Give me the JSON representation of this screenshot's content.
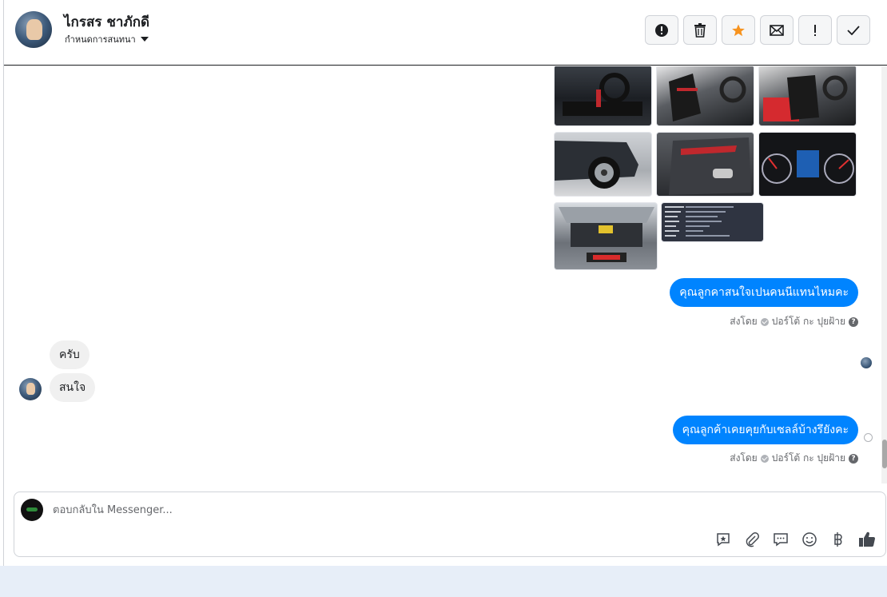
{
  "header": {
    "contact_name": "ไกรสร ชาภักดี",
    "assign_label": "กำหนดการสนทนา",
    "actions": [
      {
        "name": "mark-spam-button",
        "icon": "alert-circle-icon"
      },
      {
        "name": "delete-button",
        "icon": "trash-icon"
      },
      {
        "name": "star-button",
        "icon": "star-icon"
      },
      {
        "name": "mark-unread-button",
        "icon": "envelope-icon"
      },
      {
        "name": "follow-up-button",
        "icon": "exclamation-icon"
      },
      {
        "name": "mark-done-button",
        "icon": "check-icon"
      }
    ]
  },
  "messages": {
    "out_1": "คุณลูกคาสนใจเปนคนนีแทนไหมคะ",
    "out_1_sentby": "ส่งโดย",
    "out_1_sender": "ปอร์โต้ กะ ปุยฝ้าย",
    "in_1": "ครับ",
    "in_2": "สนใจ",
    "out_2": "คุณลูกค้าเคยคุยกับเซลล์บ้างรึยังคะ",
    "out_2_sentby": "ส่งโดย",
    "out_2_sender": "ปอร์โต้ กะ ปุยฝ้าย"
  },
  "composer": {
    "placeholder": "ตอบกลับใน Messenger..."
  },
  "colors": {
    "accent": "#0084ff",
    "star": "#f7931e"
  }
}
